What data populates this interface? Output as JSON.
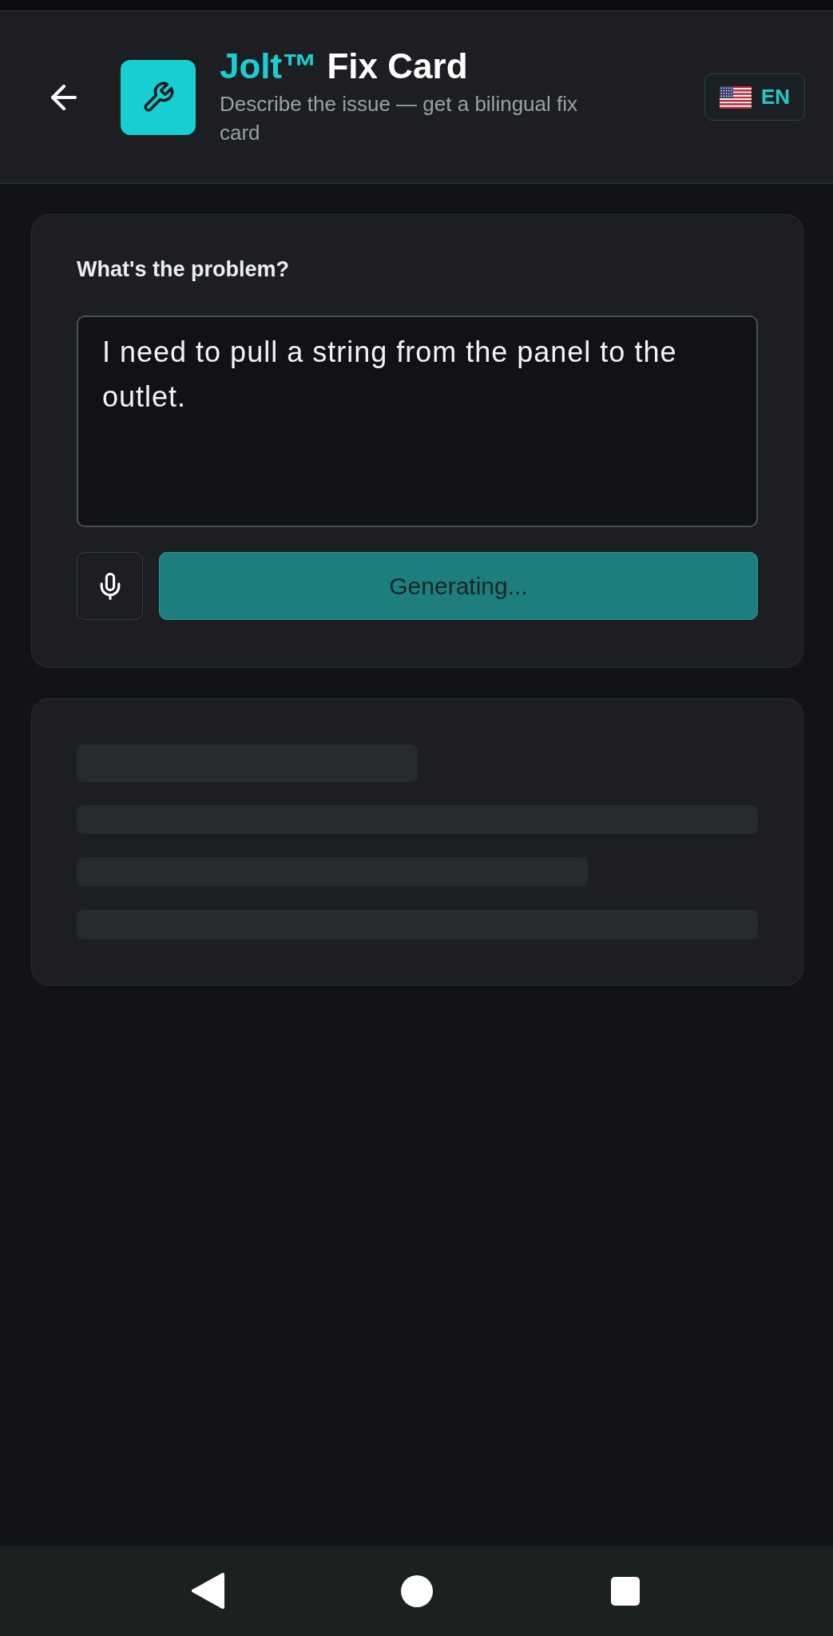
{
  "header": {
    "title": {
      "brand": "Jolt™",
      "rest": "Fix Card"
    },
    "subtitle": "Describe the issue — get a bilingual fix card",
    "language_button": {
      "label": "EN"
    }
  },
  "problem_card": {
    "label": "What's the problem?",
    "input": {
      "value": "I need to pull a string from the panel to the outlet."
    },
    "generate_button": {
      "label": "Generating...",
      "disabled": true
    }
  },
  "result_card": {
    "loading": true
  }
}
